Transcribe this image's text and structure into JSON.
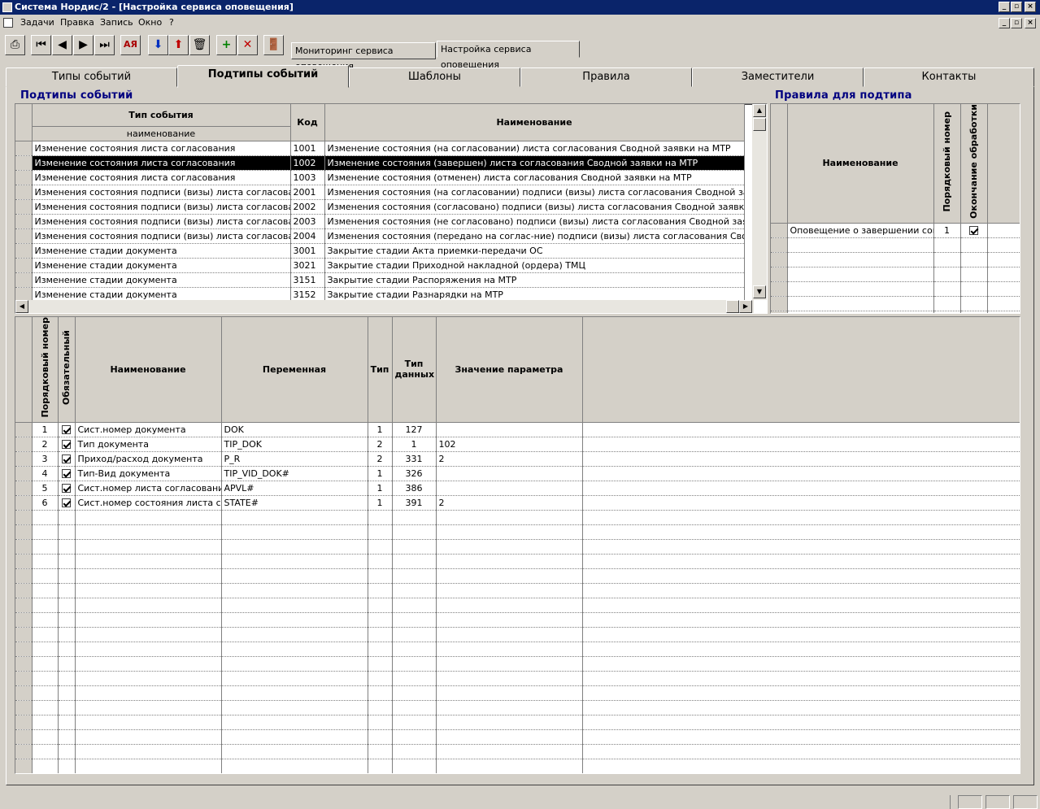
{
  "window": {
    "title": "Система Нордис/2 - [Настройка сервиса оповещения]"
  },
  "menu": [
    "Задачи",
    "Правка",
    "Запись",
    "Окно",
    "?"
  ],
  "toolbar": {
    "icons": [
      "print-icon",
      "first-record-icon",
      "prev-record-icon",
      "next-record-icon",
      "last-record-icon",
      "sort-icon",
      "save-icon",
      "save-exit-icon",
      "delete-icon",
      "add-record-icon",
      "delete-record-icon",
      "exit-icon"
    ]
  },
  "doc_tabs": [
    "Мониторинг сервиса оповещения",
    "Настройка сервиса оповещения"
  ],
  "main_tabs": [
    "Типы событий",
    "Подтипы событий",
    "Шаблоны",
    "Правила",
    "Заместители",
    "Контакты"
  ],
  "subtypes": {
    "title": "Подтипы событий",
    "headers": {
      "event_type": "Тип события",
      "event_sub": "наименование",
      "code": "Код",
      "name": "Наименование"
    },
    "rows": [
      {
        "type": "Изменение состояния листа согласования",
        "code": "1001",
        "name": "Изменение состояния (на согласовании) листа согласования Сводной заявки на МТР"
      },
      {
        "type": "Изменение состояния листа согласования",
        "code": "1002",
        "name": "Изменение состояния (завершен) листа согласования Сводной заявки на МТР"
      },
      {
        "type": "Изменение состояния листа согласования",
        "code": "1003",
        "name": "Изменение состояния (отменен) листа согласования Сводной заявки на МТР"
      },
      {
        "type": "Изменения состояния подписи (визы) листа согласования",
        "code": "2001",
        "name": "Изменения состояния (на согласовании) подписи (визы) листа согласования Сводной заявки на М"
      },
      {
        "type": "Изменения состояния подписи (визы) листа согласования",
        "code": "2002",
        "name": "Изменения состояния (согласовано) подписи (визы) листа согласования Сводной заявки на МТР"
      },
      {
        "type": "Изменения состояния подписи (визы) листа согласования",
        "code": "2003",
        "name": "Изменения состояния (не согласовано) подписи (визы) листа согласования Сводной заявки на МТ"
      },
      {
        "type": "Изменения состояния подписи (визы) листа согласования",
        "code": "2004",
        "name": "Изменения состояния (передано на соглас-ние) подписи (визы) листа согласования Сводной заявк"
      },
      {
        "type": "Изменение стадии документа",
        "code": "3001",
        "name": "Закрытие стадии Акта приемки-передачи ОС"
      },
      {
        "type": "Изменение стадии документа",
        "code": "3021",
        "name": "Закрытие стадии Приходной накладной (ордера) ТМЦ"
      },
      {
        "type": "Изменение стадии документа",
        "code": "3151",
        "name": "Закрытие стадии Распоряжения на МТР"
      },
      {
        "type": "Изменение стадии документа",
        "code": "3152",
        "name": "Закрытие стадии Разнарядки на МТР"
      }
    ]
  },
  "rules": {
    "title": "Правила для подтипа",
    "headers": {
      "name": "Наименование",
      "order": "Порядковый номер",
      "end": "Окончание обработки"
    },
    "rows": [
      {
        "name": "Оповещение о завершении соглас",
        "order": "1",
        "end": true
      }
    ]
  },
  "params": {
    "headers": {
      "order": "Порядковый номер",
      "required": "Обязательный",
      "name": "Наименование",
      "variable": "Переменная",
      "type": "Тип",
      "dtype": "Тип данных",
      "value": "Значение параметра"
    },
    "rows": [
      {
        "order": "1",
        "required": true,
        "name": "Сист.номер документа",
        "variable": "DOK",
        "type": "1",
        "dtype": "127",
        "value": ""
      },
      {
        "order": "2",
        "required": true,
        "name": "Тип документа",
        "variable": "TIP_DOK",
        "type": "2",
        "dtype": "1",
        "value": "102"
      },
      {
        "order": "3",
        "required": true,
        "name": "Приход/расход документа",
        "variable": "P_R",
        "type": "2",
        "dtype": "331",
        "value": "2"
      },
      {
        "order": "4",
        "required": true,
        "name": "Тип-Вид документа",
        "variable": "TIP_VID_DOK#",
        "type": "1",
        "dtype": "326",
        "value": ""
      },
      {
        "order": "5",
        "required": true,
        "name": "Сист.номер листа согласования",
        "variable": "APVL#",
        "type": "1",
        "dtype": "386",
        "value": ""
      },
      {
        "order": "6",
        "required": true,
        "name": "Сист.номер состояния листа согласования",
        "variable": "STATE#",
        "type": "1",
        "dtype": "391",
        "value": "2"
      }
    ]
  }
}
